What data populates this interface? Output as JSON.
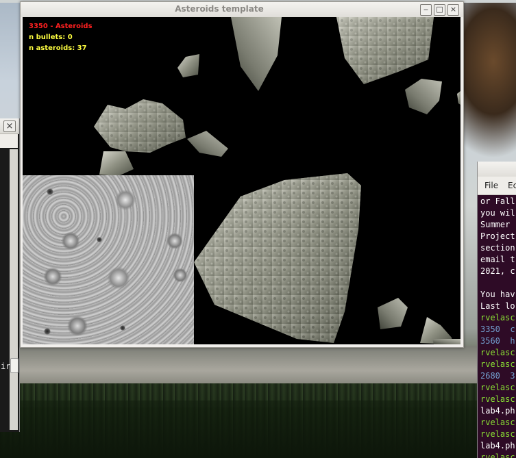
{
  "desktop": {},
  "left_window": {
    "close_glyph": "×",
    "partial_text": "ir"
  },
  "asteroids_window": {
    "title": "Asteroids template",
    "controls": {
      "minimize": "‒",
      "maximize": "□",
      "close": "×"
    },
    "hud": {
      "title_line": "3350 - Asteroids",
      "bullets_line": "n bullets: 0",
      "asteroids_line": "n asteroids: 37",
      "title_color": "#ff2020",
      "stats_color": "#ffff40"
    }
  },
  "terminal_window": {
    "menu": [
      "File",
      "Ec"
    ],
    "lines": [
      {
        "text": "or Fall",
        "color": "#ffffff"
      },
      {
        "text": "you wil",
        "color": "#ffffff"
      },
      {
        "text": "Summer",
        "color": "#ffffff"
      },
      {
        "text": "Project",
        "color": "#ffffff"
      },
      {
        "text": "section",
        "color": "#ffffff"
      },
      {
        "text": "email t",
        "color": "#ffffff"
      },
      {
        "text": "2021, c",
        "color": "#ffffff"
      },
      {
        "text": "",
        "color": "#ffffff"
      },
      {
        "text": "You hav",
        "color": "#ffffff"
      },
      {
        "text": "Last lo",
        "color": "#ffffff"
      },
      {
        "text": "rvelasc",
        "color": "#8ae234"
      },
      {
        "text": "3350  c",
        "color": "#729fcf"
      },
      {
        "text": "3560  h",
        "color": "#729fcf"
      },
      {
        "text": "rvelasc",
        "color": "#8ae234"
      },
      {
        "text": "rvelasc",
        "color": "#8ae234"
      },
      {
        "text": "2680  3",
        "color": "#729fcf"
      },
      {
        "text": "rvelasc",
        "color": "#8ae234"
      },
      {
        "text": "rvelasc",
        "color": "#8ae234"
      },
      {
        "text": "lab4.ph",
        "color": "#ffffff"
      },
      {
        "text": "rvelasc",
        "color": "#8ae234"
      },
      {
        "text": "rvelasc",
        "color": "#8ae234"
      },
      {
        "text": "lab4.ph",
        "color": "#ffffff"
      },
      {
        "text": "rvelasc",
        "color": "#8ae234"
      }
    ]
  }
}
